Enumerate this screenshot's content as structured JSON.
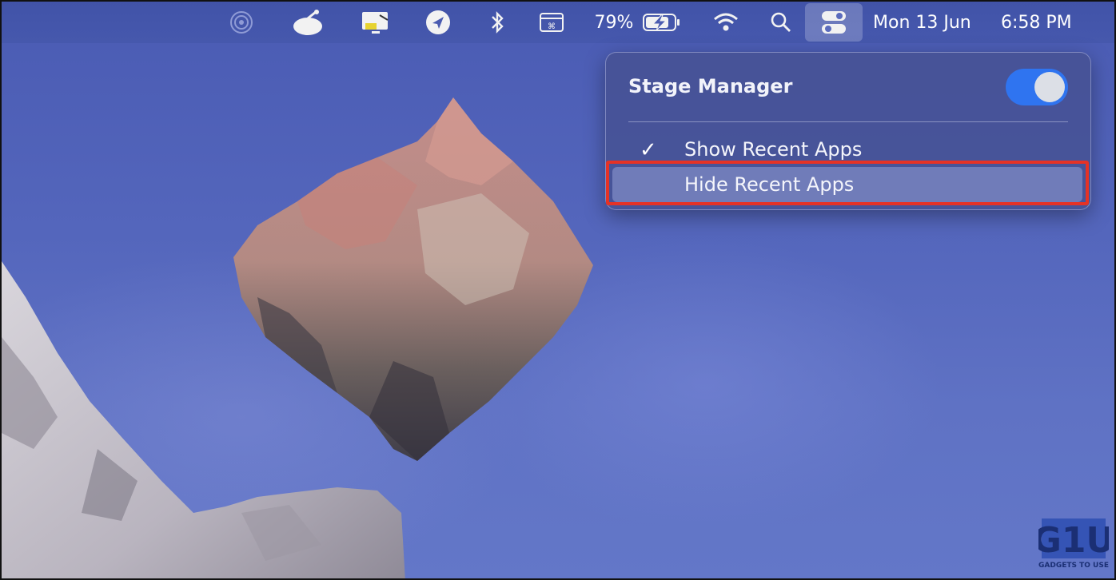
{
  "menubar": {
    "battery_percent": "79%",
    "date": "Mon 13 Jun",
    "time": "6:58 PM",
    "icons": [
      "airdrop-icon",
      "app-status-icon",
      "screen-share-icon",
      "location-icon",
      "bluetooth-icon",
      "keyboard-viewer-icon",
      "battery-charging-icon",
      "wifi-icon",
      "search-icon",
      "control-center-icon"
    ]
  },
  "popup": {
    "title": "Stage Manager",
    "toggle_on": true,
    "items": [
      {
        "label": "Show Recent Apps",
        "checked": true
      },
      {
        "label": "Hide Recent Apps",
        "checked": false
      }
    ]
  },
  "watermark": "GADGETS TO USE",
  "colors": {
    "accent_toggle": "#2f74f0",
    "highlight_box": "#e53226"
  }
}
